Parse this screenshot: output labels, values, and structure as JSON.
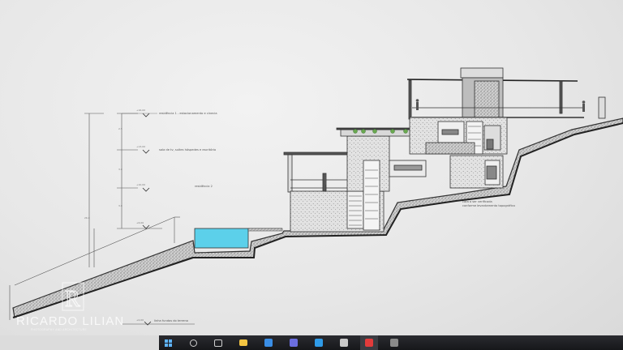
{
  "drawing": {
    "labels": {
      "l1": "residência 1 - estacionamento e cinecia",
      "l2": "sala de tv, suítes hóspedes e escritório",
      "l3": "residência 2",
      "l4": "linha fundos do terreno",
      "n1": "cota a ser verificada",
      "n2": "conforme levantamento topográfico"
    },
    "levels": {
      "v1": "+16,00",
      "v2": "+13,00",
      "v3": "+10,00",
      "v4": "+6,00",
      "v5": "+0,00",
      "d1": "2.5",
      "d2": "3.0",
      "d3": "3.0",
      "d4": "26.0"
    },
    "colors": {
      "line": "#333333",
      "pool": "#5cd0ea",
      "hatch": "#8c8c8c"
    }
  },
  "watermark": {
    "logo_letter": "R",
    "brand": "RICARDO LILIAN",
    "tagline": "PHOTOGRAPHY AND ARCHITECTURE"
  },
  "taskbar": {
    "icons": [
      {
        "name": "windows-start-icon",
        "color": "#5fb4ff"
      },
      {
        "name": "search-icon",
        "color": "#cfcfcf"
      },
      {
        "name": "task-view-icon",
        "color": "#cfcfcf"
      },
      {
        "name": "file-explorer-icon",
        "color": "#f4c542"
      },
      {
        "name": "mail-icon",
        "color": "#3a8ee6"
      },
      {
        "name": "teams-icon",
        "color": "#6b6ee0"
      },
      {
        "name": "store-icon",
        "color": "#2f9be8"
      },
      {
        "name": "autocad-icon",
        "color": "#e23b3b"
      },
      {
        "name": "app-icon",
        "color": "#c9c9c9"
      },
      {
        "name": "app-icon-2",
        "color": "#8a8a8a"
      }
    ]
  }
}
